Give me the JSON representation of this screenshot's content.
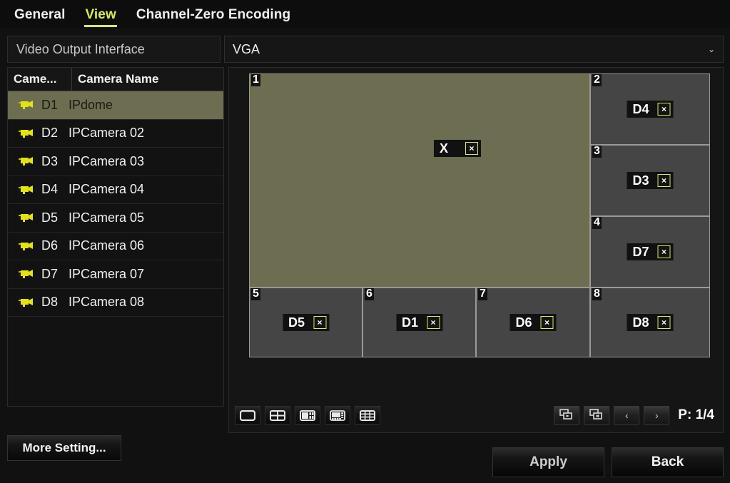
{
  "tabs": [
    {
      "label": "General",
      "active": false
    },
    {
      "label": "View",
      "active": true
    },
    {
      "label": "Channel-Zero Encoding",
      "active": false
    }
  ],
  "video_output": {
    "label": "Video Output Interface",
    "value": "VGA",
    "chevron": "⌄"
  },
  "camera_table": {
    "headers": {
      "col1": "Came...",
      "col2": "Camera Name"
    },
    "rows": [
      {
        "id": "D1",
        "name": "IPdome",
        "selected": true
      },
      {
        "id": "D2",
        "name": "IPCamera 02",
        "selected": false
      },
      {
        "id": "D3",
        "name": "IPCamera 03",
        "selected": false
      },
      {
        "id": "D4",
        "name": "IPCamera 04",
        "selected": false
      },
      {
        "id": "D5",
        "name": "IPCamera 05",
        "selected": false
      },
      {
        "id": "D6",
        "name": "IPCamera 06",
        "selected": false
      },
      {
        "id": "D7",
        "name": "IPCamera 07",
        "selected": false
      },
      {
        "id": "D8",
        "name": "IPCamera 08",
        "selected": false
      }
    ]
  },
  "more_setting": {
    "label": "More Setting..."
  },
  "layout_grid": {
    "cells": [
      {
        "num": "1",
        "camera": "X",
        "close": "×",
        "big": true
      },
      {
        "num": "2",
        "camera": "D4",
        "close": "×",
        "big": false
      },
      {
        "num": "3",
        "camera": "D3",
        "close": "×",
        "big": false
      },
      {
        "num": "4",
        "camera": "D7",
        "close": "×",
        "big": false
      },
      {
        "num": "5",
        "camera": "D5",
        "close": "×",
        "big": false
      },
      {
        "num": "6",
        "camera": "D1",
        "close": "×",
        "big": false
      },
      {
        "num": "7",
        "camera": "D6",
        "close": "×",
        "big": false
      },
      {
        "num": "8",
        "camera": "D8",
        "close": "×",
        "big": false
      }
    ]
  },
  "preview_toolbar": {
    "layout_buttons": [
      {
        "name": "layout-1x1-icon"
      },
      {
        "name": "layout-2x2-icon"
      },
      {
        "name": "layout-1plus5-icon"
      },
      {
        "name": "layout-1plus7-icon"
      },
      {
        "name": "layout-grid-icon"
      }
    ],
    "start_tour": "start-tour-icon",
    "stop_tour": "stop-tour-icon",
    "prev_label": "‹",
    "next_label": "›",
    "page_label": "P: 1/4"
  },
  "footer": {
    "apply_label": "Apply",
    "back_label": "Back"
  },
  "colors": {
    "accent": "#d9ec4f",
    "highlight_olive": "#6d6d52",
    "cell_gray": "#454545",
    "background": "#111111"
  }
}
